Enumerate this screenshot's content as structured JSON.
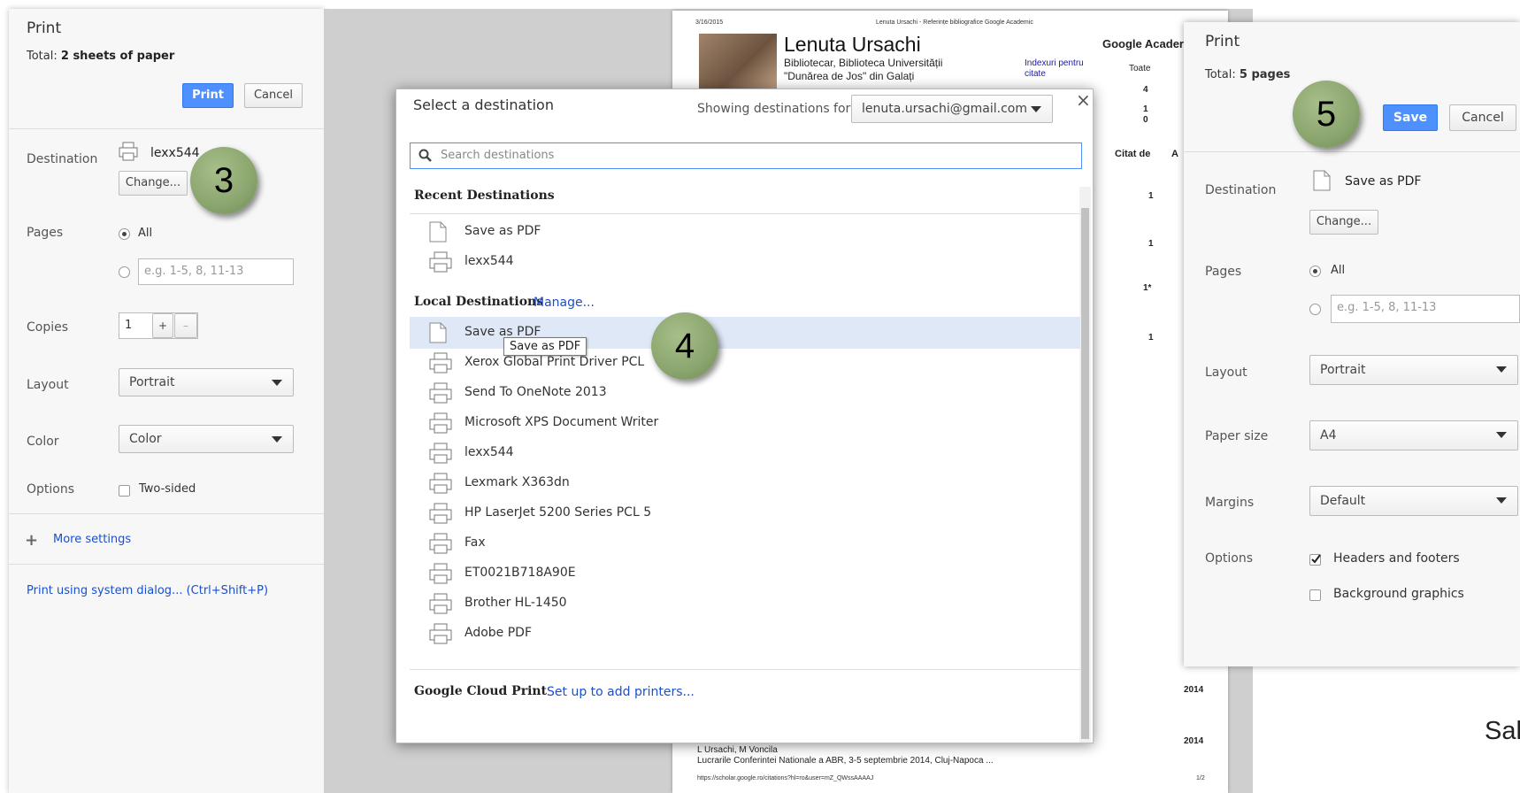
{
  "left_panel": {
    "title": "Print",
    "total_prefix": "Total: ",
    "total_value": "2 sheets of paper",
    "print_button": "Print",
    "cancel_button": "Cancel",
    "destination_label": "Destination",
    "destination_value": "lexx544",
    "change_button": "Change...",
    "pages_label": "Pages",
    "pages_all": "All",
    "pages_placeholder": "e.g. 1-5, 8, 11-13",
    "copies_label": "Copies",
    "copies_value": "1",
    "copies_plus": "+",
    "copies_minus": "–",
    "layout_label": "Layout",
    "layout_value": "Portrait",
    "color_label": "Color",
    "color_value": "Color",
    "options_label": "Options",
    "two_sided": "Two-sided",
    "more_settings": "More settings",
    "system_dialog": "Print using system dialog... (Ctrl+Shift+P)"
  },
  "badges": {
    "step3": "3",
    "step4": "4",
    "step5": "5"
  },
  "background_doc": {
    "date": "3/16/2015",
    "header": "Lenuta Ursachi - Referințe bibliografice Google Academic",
    "name": "Lenuta Ursachi",
    "affiliation1": "Bibliotecar, Biblioteca Universității",
    "affiliation2": "\"Dunărea de Jos\" din Galați",
    "brand": "Google Acader",
    "indexes_line1": "Indexuri pentru",
    "indexes_line2": "citate",
    "toate": "Toate",
    "stat_values": [
      "4",
      "1",
      "0"
    ],
    "citat_de": "Citat de",
    "col_a": "A",
    "cited_values": [
      "1",
      "1",
      "1*",
      "1"
    ],
    "years": [
      "2014",
      "2014"
    ],
    "footer_author": "L Ursachi, M Voncila",
    "footer_title": "Lucrarile Conferintei Nationale a ABR, 3-5 septembrie 2014, Cluj-Napoca ...",
    "footer_url": "https://scholar.google.ro/citations?hl=ro&user=mZ_QWssAAAAJ",
    "footer_page": "1/2"
  },
  "dialog": {
    "title": "Select a destination",
    "showing_for": "Showing destinations for",
    "account": "lenuta.ursachi@gmail.com",
    "close": "×",
    "search_placeholder": "Search destinations",
    "recent_heading": "Recent Destinations",
    "recent": [
      {
        "label": "Save as PDF",
        "icon": "doc"
      },
      {
        "label": "lexx544",
        "icon": "printer"
      }
    ],
    "local_heading": "Local Destinations",
    "manage": "Manage...",
    "local": [
      {
        "label": "Save as PDF",
        "icon": "doc"
      },
      {
        "label": "Xerox Global Print Driver PCL",
        "icon": "printer"
      },
      {
        "label": "Send To OneNote 2013",
        "icon": "printer"
      },
      {
        "label": "Microsoft XPS Document Writer",
        "icon": "printer"
      },
      {
        "label": "lexx544",
        "icon": "printer"
      },
      {
        "label": "Lexmark X363dn",
        "icon": "printer"
      },
      {
        "label": "HP LaserJet 5200 Series PCL 5",
        "icon": "printer"
      },
      {
        "label": "Fax",
        "icon": "printer"
      },
      {
        "label": "ET0021B718A90E",
        "icon": "printer"
      },
      {
        "label": "Brother HL-1450",
        "icon": "printer"
      },
      {
        "label": "Adobe PDF",
        "icon": "printer"
      }
    ],
    "tooltip": "Save as PDF",
    "cloud_heading": "Google Cloud Print",
    "cloud_link": "Set up to add printers..."
  },
  "right_panel": {
    "title": "Print",
    "total_prefix": "Total: ",
    "total_value": "5 pages",
    "save_button": "Save",
    "cancel_button": "Cancel",
    "destination_label": "Destination",
    "destination_value": "Save as PDF",
    "change_button": "Change...",
    "pages_label": "Pages",
    "pages_all": "All",
    "pages_placeholder": "e.g. 1-5, 8, 11-13",
    "layout_label": "Layout",
    "layout_value": "Portrait",
    "paper_label": "Paper size",
    "paper_value": "A4",
    "margins_label": "Margins",
    "margins_value": "Default",
    "options_label": "Options",
    "headers_footers": "Headers and footers",
    "background_graphics": "Background graphics"
  },
  "caption": "Salva"
}
